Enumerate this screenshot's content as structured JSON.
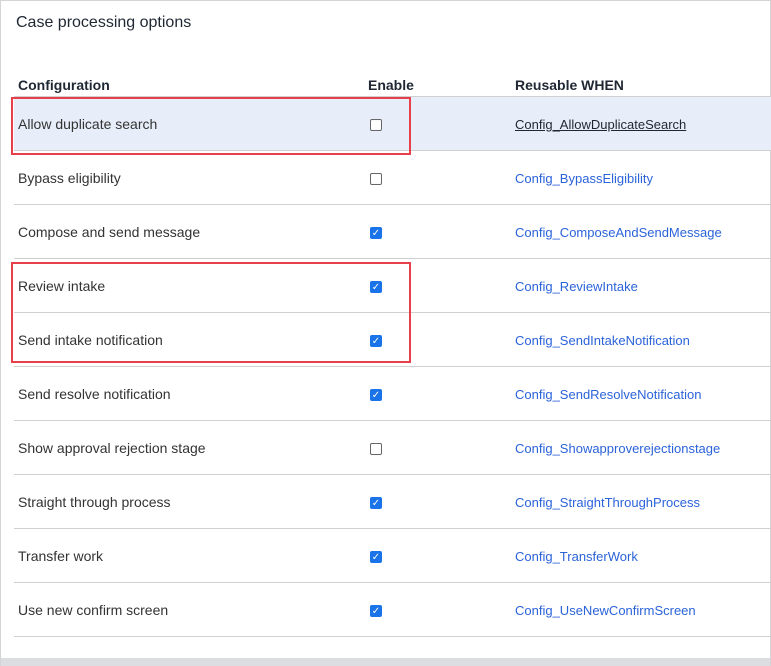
{
  "title": "Case processing options",
  "columns": [
    "Configuration",
    "Enable",
    "Reusable WHEN"
  ],
  "rows": [
    {
      "label": "Allow duplicate search",
      "enabled": false,
      "when": "Config_AllowDuplicateSearch",
      "selected": true
    },
    {
      "label": "Bypass eligibility",
      "enabled": false,
      "when": "Config_BypassEligibility"
    },
    {
      "label": "Compose and send message",
      "enabled": true,
      "when": "Config_ComposeAndSendMessage"
    },
    {
      "label": "Review intake",
      "enabled": true,
      "when": "Config_ReviewIntake"
    },
    {
      "label": "Send intake notification",
      "enabled": true,
      "when": "Config_SendIntakeNotification"
    },
    {
      "label": "Send resolve notification",
      "enabled": true,
      "when": "Config_SendResolveNotification"
    },
    {
      "label": "Show approval rejection stage",
      "enabled": false,
      "when": "Config_Showapproverejectionstage"
    },
    {
      "label": "Straight through process",
      "enabled": true,
      "when": "Config_StraightThroughProcess"
    },
    {
      "label": "Transfer work",
      "enabled": true,
      "when": "Config_TransferWork"
    },
    {
      "label": "Use new confirm screen",
      "enabled": true,
      "when": "Config_UseNewConfirmScreen"
    }
  ],
  "colors": {
    "accent": "#1a73e8",
    "link": "#2b63d9",
    "highlight": "#e8404a",
    "selected_row": "#e8eef9"
  }
}
